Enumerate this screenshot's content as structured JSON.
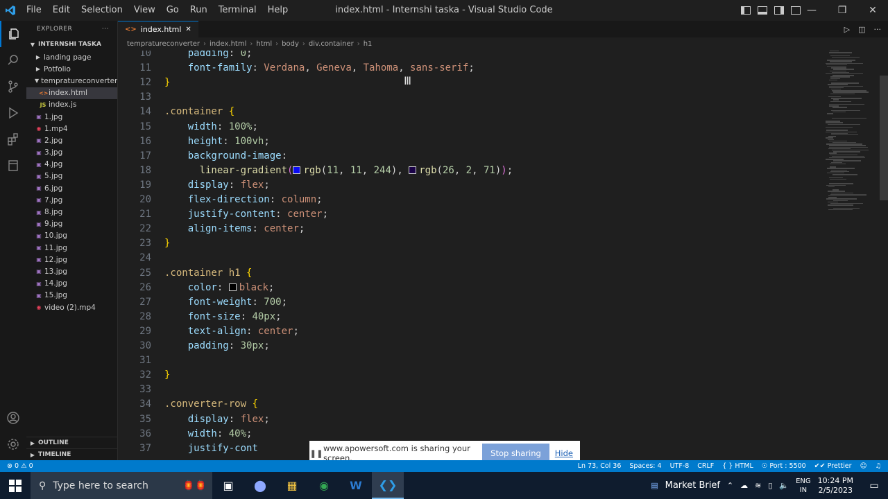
{
  "window": {
    "title": "index.html - Internshi taska - Visual Studio Code",
    "menu": [
      "File",
      "Edit",
      "Selection",
      "View",
      "Go",
      "Run",
      "Terminal",
      "Help"
    ]
  },
  "activity_bar": {
    "icons": [
      "files-icon",
      "search-icon",
      "source-control-icon",
      "run-debug-icon",
      "extensions-icon",
      "remote-explorer-icon"
    ],
    "bottom_icons": [
      "account-icon",
      "settings-gear-icon"
    ]
  },
  "sidebar": {
    "header": "EXPLORER",
    "more": "···",
    "workspace": "INTERNSHI TASKA",
    "items": [
      {
        "label": "landing page",
        "kind": "folder",
        "depth": 1
      },
      {
        "label": "Potfolio",
        "kind": "folder",
        "depth": 1
      },
      {
        "label": "tempratureconverter",
        "kind": "folder-open",
        "depth": 1
      },
      {
        "label": "index.html",
        "kind": "html",
        "depth": 2,
        "selected": true
      },
      {
        "label": "index.js",
        "kind": "js",
        "depth": 2
      },
      {
        "label": "1.jpg",
        "kind": "image",
        "depth": 1
      },
      {
        "label": "1.mp4",
        "kind": "video",
        "depth": 1
      },
      {
        "label": "2.jpg",
        "kind": "image",
        "depth": 1
      },
      {
        "label": "3.jpg",
        "kind": "image",
        "depth": 1
      },
      {
        "label": "4.jpg",
        "kind": "image",
        "depth": 1
      },
      {
        "label": "5.jpg",
        "kind": "image",
        "depth": 1
      },
      {
        "label": "6.jpg",
        "kind": "image",
        "depth": 1
      },
      {
        "label": "7.jpg",
        "kind": "image",
        "depth": 1
      },
      {
        "label": "8.jpg",
        "kind": "image",
        "depth": 1
      },
      {
        "label": "9.jpg",
        "kind": "image",
        "depth": 1
      },
      {
        "label": "10.jpg",
        "kind": "image",
        "depth": 1
      },
      {
        "label": "11.jpg",
        "kind": "image",
        "depth": 1
      },
      {
        "label": "12.jpg",
        "kind": "image",
        "depth": 1
      },
      {
        "label": "13.jpg",
        "kind": "image",
        "depth": 1
      },
      {
        "label": "14.jpg",
        "kind": "image",
        "depth": 1
      },
      {
        "label": "15.jpg",
        "kind": "image",
        "depth": 1
      },
      {
        "label": "video (2).mp4",
        "kind": "video",
        "depth": 1
      }
    ],
    "outline": "OUTLINE",
    "timeline": "TIMELINE"
  },
  "tabs": [
    {
      "label": "index.html",
      "active": true
    }
  ],
  "breadcrumbs": [
    "tempratureconverter",
    "index.html",
    "html",
    "body",
    "div.container",
    "h1"
  ],
  "editor": {
    "lines": [
      {
        "n": 10,
        "tokens": [
          [
            "    ",
            "punc"
          ],
          [
            "padding",
            "prop"
          ],
          [
            ": ",
            "punc"
          ],
          [
            "0",
            "num"
          ],
          [
            ";",
            "punc"
          ]
        ]
      },
      {
        "n": 11,
        "tokens": [
          [
            "    ",
            "punc"
          ],
          [
            "font-family",
            "prop"
          ],
          [
            ": ",
            "punc"
          ],
          [
            "Verdana",
            "val"
          ],
          [
            ", ",
            "punc"
          ],
          [
            "Geneva",
            "val"
          ],
          [
            ", ",
            "punc"
          ],
          [
            "Tahoma",
            "val"
          ],
          [
            ", ",
            "punc"
          ],
          [
            "sans-serif",
            "val"
          ],
          [
            ";",
            "punc"
          ]
        ]
      },
      {
        "n": 12,
        "tokens": [
          [
            "}",
            "brace"
          ]
        ]
      },
      {
        "n": 13,
        "tokens": []
      },
      {
        "n": 14,
        "tokens": [
          [
            ".container ",
            "sel"
          ],
          [
            "{",
            "brace"
          ]
        ]
      },
      {
        "n": 15,
        "tokens": [
          [
            "    ",
            "punc"
          ],
          [
            "width",
            "prop"
          ],
          [
            ": ",
            "punc"
          ],
          [
            "100%",
            "num"
          ],
          [
            ";",
            "punc"
          ]
        ]
      },
      {
        "n": 16,
        "tokens": [
          [
            "    ",
            "punc"
          ],
          [
            "height",
            "prop"
          ],
          [
            ": ",
            "punc"
          ],
          [
            "100vh",
            "num"
          ],
          [
            ";",
            "punc"
          ]
        ]
      },
      {
        "n": 17,
        "tokens": [
          [
            "    ",
            "punc"
          ],
          [
            "background-image",
            "prop"
          ],
          [
            ":",
            "punc"
          ]
        ]
      },
      {
        "n": 18,
        "tokens": [
          [
            "      ",
            "punc"
          ],
          [
            "linear-gradient",
            "fn"
          ],
          [
            "(",
            "paren"
          ],
          [
            "#0b0bf4",
            "swatch"
          ],
          [
            "rgb",
            "fn"
          ],
          [
            "(",
            "punc"
          ],
          [
            "11",
            "num"
          ],
          [
            ", ",
            "punc"
          ],
          [
            "11",
            "num"
          ],
          [
            ", ",
            "punc"
          ],
          [
            "244",
            "num"
          ],
          [
            "), ",
            "punc"
          ],
          [
            "#1a0247",
            "swatch"
          ],
          [
            "rgb",
            "fn"
          ],
          [
            "(",
            "punc"
          ],
          [
            "26",
            "num"
          ],
          [
            ", ",
            "punc"
          ],
          [
            "2",
            "num"
          ],
          [
            ", ",
            "punc"
          ],
          [
            "71",
            "num"
          ],
          [
            ")",
            "punc"
          ],
          [
            ")",
            "paren"
          ],
          [
            ";",
            "punc"
          ]
        ]
      },
      {
        "n": 19,
        "tokens": [
          [
            "    ",
            "punc"
          ],
          [
            "display",
            "prop"
          ],
          [
            ": ",
            "punc"
          ],
          [
            "flex",
            "val"
          ],
          [
            ";",
            "punc"
          ]
        ]
      },
      {
        "n": 20,
        "tokens": [
          [
            "    ",
            "punc"
          ],
          [
            "flex-direction",
            "prop"
          ],
          [
            ": ",
            "punc"
          ],
          [
            "column",
            "val"
          ],
          [
            ";",
            "punc"
          ]
        ]
      },
      {
        "n": 21,
        "tokens": [
          [
            "    ",
            "punc"
          ],
          [
            "justify-content",
            "prop"
          ],
          [
            ": ",
            "punc"
          ],
          [
            "center",
            "val"
          ],
          [
            ";",
            "punc"
          ]
        ]
      },
      {
        "n": 22,
        "tokens": [
          [
            "    ",
            "punc"
          ],
          [
            "align-items",
            "prop"
          ],
          [
            ": ",
            "punc"
          ],
          [
            "center",
            "val"
          ],
          [
            ";",
            "punc"
          ]
        ]
      },
      {
        "n": 23,
        "tokens": [
          [
            "}",
            "brace"
          ]
        ]
      },
      {
        "n": 24,
        "tokens": []
      },
      {
        "n": 25,
        "tokens": [
          [
            ".container h1 ",
            "sel"
          ],
          [
            "{",
            "brace"
          ]
        ]
      },
      {
        "n": 26,
        "tokens": [
          [
            "    ",
            "punc"
          ],
          [
            "color",
            "prop"
          ],
          [
            ": ",
            "punc"
          ],
          [
            "#000000",
            "swatch"
          ],
          [
            "black",
            "val"
          ],
          [
            ";",
            "punc"
          ]
        ]
      },
      {
        "n": 27,
        "tokens": [
          [
            "    ",
            "punc"
          ],
          [
            "font-weight",
            "prop"
          ],
          [
            ": ",
            "punc"
          ],
          [
            "700",
            "num"
          ],
          [
            ";",
            "punc"
          ]
        ]
      },
      {
        "n": 28,
        "tokens": [
          [
            "    ",
            "punc"
          ],
          [
            "font-size",
            "prop"
          ],
          [
            ": ",
            "punc"
          ],
          [
            "40px",
            "num"
          ],
          [
            ";",
            "punc"
          ]
        ]
      },
      {
        "n": 29,
        "tokens": [
          [
            "    ",
            "punc"
          ],
          [
            "text-align",
            "prop"
          ],
          [
            ": ",
            "punc"
          ],
          [
            "center",
            "val"
          ],
          [
            ";",
            "punc"
          ]
        ]
      },
      {
        "n": 30,
        "tokens": [
          [
            "    ",
            "punc"
          ],
          [
            "padding",
            "prop"
          ],
          [
            ": ",
            "punc"
          ],
          [
            "30px",
            "num"
          ],
          [
            ";",
            "punc"
          ]
        ]
      },
      {
        "n": 31,
        "tokens": []
      },
      {
        "n": 32,
        "tokens": [
          [
            "}",
            "brace"
          ]
        ]
      },
      {
        "n": 33,
        "tokens": []
      },
      {
        "n": 34,
        "tokens": [
          [
            ".converter-row ",
            "sel"
          ],
          [
            "{",
            "brace"
          ]
        ]
      },
      {
        "n": 35,
        "tokens": [
          [
            "    ",
            "punc"
          ],
          [
            "display",
            "prop"
          ],
          [
            ": ",
            "punc"
          ],
          [
            "flex",
            "val"
          ],
          [
            ";",
            "punc"
          ]
        ]
      },
      {
        "n": 36,
        "tokens": [
          [
            "    ",
            "punc"
          ],
          [
            "width",
            "prop"
          ],
          [
            ": ",
            "punc"
          ],
          [
            "40%",
            "num"
          ],
          [
            ";",
            "punc"
          ]
        ]
      },
      {
        "n": 37,
        "tokens": [
          [
            "    ",
            "punc"
          ],
          [
            "justify-cont",
            "prop"
          ]
        ]
      }
    ]
  },
  "share_bar": {
    "message": "www.apowersoft.com is sharing your screen.",
    "stop_label": "Stop sharing",
    "hide_label": "Hide"
  },
  "status_bar": {
    "errors": "0",
    "warnings": "0",
    "position": "Ln 73, Col 36",
    "spaces": "Spaces: 4",
    "encoding": "UTF-8",
    "eol": "CRLF",
    "language": "HTML",
    "port": "Port : 5500",
    "formatter": "Prettier"
  },
  "taskbar": {
    "search_placeholder": "Type here to search",
    "apps": [
      "task-view-icon",
      "obs-icon",
      "file-explorer-icon",
      "chrome-icon",
      "word-icon",
      "vscode-icon"
    ],
    "weather": "Market Brief",
    "lang_top": "ENG",
    "lang_bottom": "IN",
    "time": "10:24 PM",
    "date": "2/5/2023"
  },
  "colors": {
    "accent": "#0078d4",
    "statusbar": "#007acc"
  }
}
